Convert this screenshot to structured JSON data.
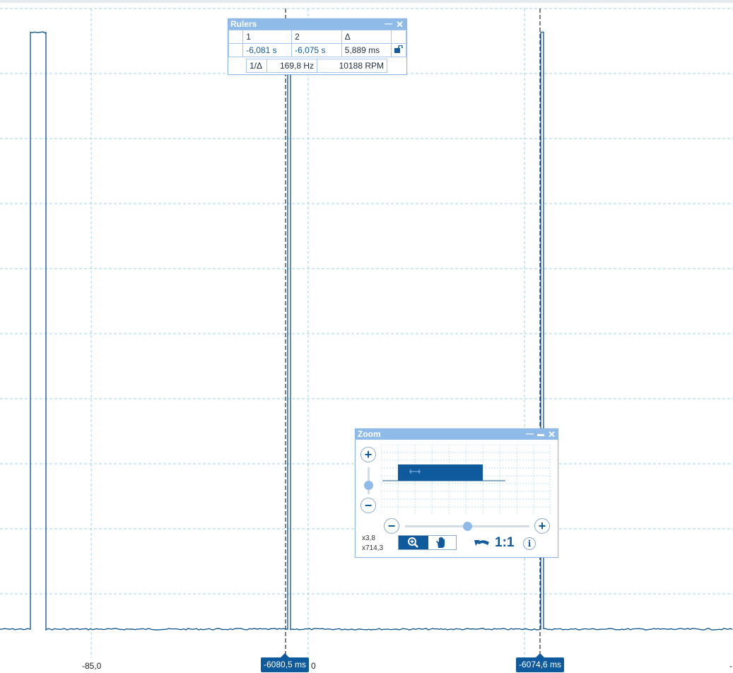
{
  "axis": {
    "tick_label": "-85,0",
    "tick_right_fragment": "0",
    "tick_edge_fragment": "-"
  },
  "cursors": {
    "left_label": "-6080,5 ms",
    "right_label": "-6074,6 ms"
  },
  "rulers": {
    "title": "Rulers",
    "headers": [
      "1",
      "2",
      "Δ"
    ],
    "values": [
      "-6,081 s",
      "-6,075 s",
      "5,889 ms"
    ],
    "reciprocal_label": "1/Δ",
    "frequency": "169,8 Hz",
    "rpm": "10188 RPM",
    "minimize_glyph": "—",
    "close_glyph": "✕",
    "lock_icon": "lock-open-icon"
  },
  "zoom": {
    "title": "Zoom",
    "x_factor": "x3,8",
    "y_factor": "x714,3",
    "one_to_one_label": "1:1",
    "plus_glyph": "+",
    "minus_glyph": "−",
    "info_glyph": "i",
    "minimize_glyph": "—",
    "maximize_glyph": "▬",
    "close_glyph": "✕",
    "vertical_zoom_level": 0.35,
    "horizontal_zoom_level": 0.5
  },
  "colors": {
    "trace": "#1a5c96",
    "grid": "#9dd3e2",
    "accent": "#0f5a9c",
    "panel_title": "#8fbbe9"
  }
}
